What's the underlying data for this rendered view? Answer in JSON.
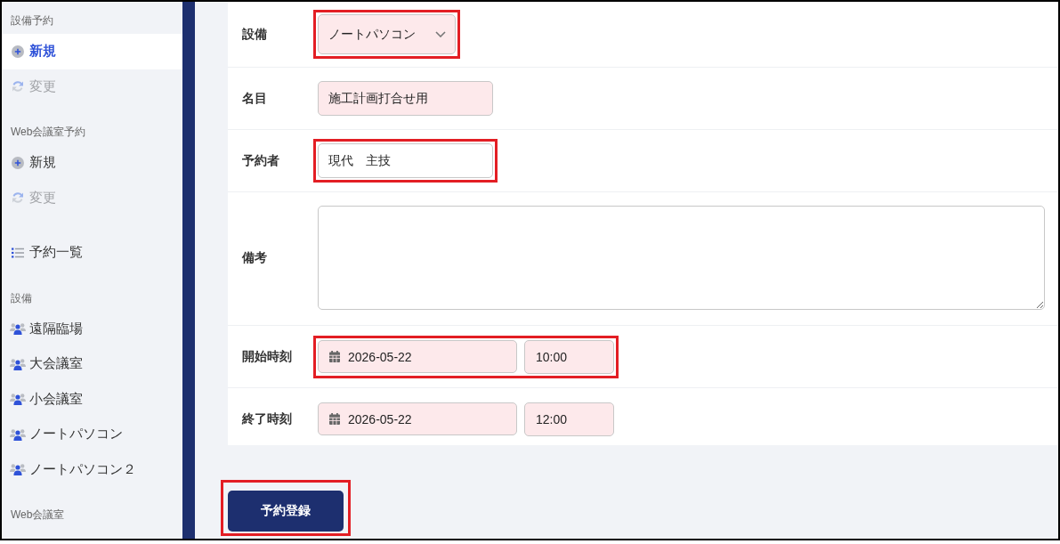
{
  "sidebar": {
    "groups": [
      {
        "heading": "設備予約",
        "items": [
          {
            "label": "新規",
            "kind": "create",
            "selected": true,
            "disabled": false
          },
          {
            "label": "変更",
            "kind": "change",
            "selected": false,
            "disabled": true
          }
        ]
      },
      {
        "heading": "Web会議室予約",
        "items": [
          {
            "label": "新規",
            "kind": "create",
            "selected": false,
            "disabled": false
          },
          {
            "label": "変更",
            "kind": "change",
            "selected": false,
            "disabled": true
          }
        ]
      },
      {
        "items": [
          {
            "label": "予約一覧",
            "kind": "list",
            "selected": false,
            "disabled": false
          }
        ]
      },
      {
        "heading": "設備",
        "items": [
          {
            "label": "遠隔臨場",
            "kind": "facility",
            "selected": false,
            "disabled": false
          },
          {
            "label": "大会議室",
            "kind": "facility",
            "selected": false,
            "disabled": false
          },
          {
            "label": "小会議室",
            "kind": "facility",
            "selected": false,
            "disabled": false
          },
          {
            "label": "ノートパソコン",
            "kind": "facility",
            "selected": false,
            "disabled": false
          },
          {
            "label": "ノートパソコン２",
            "kind": "facility",
            "selected": false,
            "disabled": false
          }
        ]
      },
      {
        "heading": "Web会議室"
      }
    ]
  },
  "form": {
    "rows": [
      {
        "label": "設備",
        "kind": "select",
        "value": "ノートパソコン",
        "required": true,
        "highlighted": true
      },
      {
        "label": "名目",
        "kind": "text",
        "value": "施工計画打合せ用",
        "required": true,
        "highlighted": false
      },
      {
        "label": "予約者",
        "kind": "text",
        "value": "現代　主技",
        "required": false,
        "highlighted": true
      },
      {
        "label": "備考",
        "kind": "textarea",
        "required": false,
        "highlighted": false
      },
      {
        "label": "開始時刻",
        "kind": "datetime",
        "date": "2026-05-22",
        "time": "10:00",
        "required": true,
        "highlighted": true
      },
      {
        "label": "終了時刻",
        "kind": "datetime",
        "date": "2026-05-22",
        "time": "12:00",
        "required": true,
        "highlighted": false
      }
    ]
  },
  "submit_button": {
    "label": "予約登録",
    "highlighted": true
  }
}
